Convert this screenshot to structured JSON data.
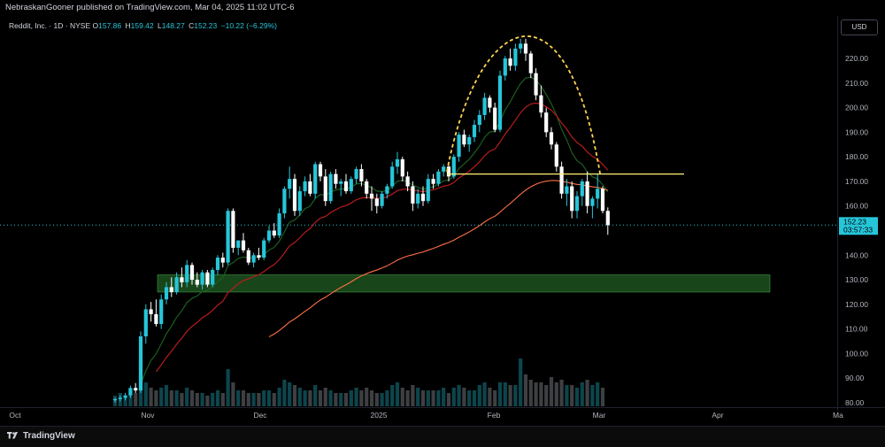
{
  "header": {
    "published": "NebraskanGooner published on TradingView.com, Mar 04, 2025 11:02 UTC-6"
  },
  "legend": {
    "symbol": "Reddit, Inc. · 1D · NYSE",
    "o_label": "O",
    "o": "157.86",
    "h_label": "H",
    "h": "159.42",
    "l_label": "L",
    "l": "148.27",
    "c_label": "C",
    "c": "152.23",
    "change": "−10.22 (−6.29%)"
  },
  "currency": "USD",
  "price_tag": {
    "price": "152.23",
    "countdown": "03:57:33"
  },
  "footer": {
    "brand": "TradingView"
  },
  "colors": {
    "up": "#26c6da",
    "down": "#ffffff",
    "ema_short": "#1b5e20",
    "ema_mid": "#b71c1c",
    "ema_long": "#ff7043",
    "arc": "#ffd54f",
    "support_line": "#fff176",
    "zone": "#2e7d32"
  },
  "chart_data": {
    "type": "candlestick",
    "ylim": [
      80,
      230
    ],
    "y_ticks": [
      80,
      90,
      100,
      110,
      120,
      130,
      140,
      150,
      160,
      170,
      180,
      190,
      200,
      210,
      220
    ],
    "x_ticks": [
      "Oct",
      "Nov",
      "Dec",
      "2025",
      "Feb",
      "Mar",
      "Apr",
      "Ma"
    ],
    "last_close": 152.23,
    "support_level": 173,
    "demand_zone": [
      125,
      132
    ],
    "candles": [
      {
        "o": 81,
        "h": 82,
        "l": 80,
        "c": 81.5
      },
      {
        "o": 81.5,
        "h": 83,
        "l": 80.5,
        "c": 82
      },
      {
        "o": 82,
        "h": 84,
        "l": 81,
        "c": 83
      },
      {
        "o": 83,
        "h": 87,
        "l": 82,
        "c": 86
      },
      {
        "o": 86,
        "h": 88,
        "l": 84,
        "c": 85
      },
      {
        "o": 85,
        "h": 109,
        "l": 84,
        "c": 107
      },
      {
        "o": 107,
        "h": 120,
        "l": 104,
        "c": 118
      },
      {
        "o": 118,
        "h": 121,
        "l": 113,
        "c": 116
      },
      {
        "o": 116,
        "h": 122,
        "l": 111,
        "c": 112
      },
      {
        "o": 112,
        "h": 124,
        "l": 110,
        "c": 122
      },
      {
        "o": 122,
        "h": 129,
        "l": 120,
        "c": 127
      },
      {
        "o": 127,
        "h": 131,
        "l": 123,
        "c": 125
      },
      {
        "o": 125,
        "h": 133,
        "l": 124,
        "c": 131
      },
      {
        "o": 131,
        "h": 135,
        "l": 127,
        "c": 129
      },
      {
        "o": 129,
        "h": 138,
        "l": 127,
        "c": 136
      },
      {
        "o": 136,
        "h": 137,
        "l": 128,
        "c": 130
      },
      {
        "o": 130,
        "h": 133,
        "l": 127,
        "c": 128
      },
      {
        "o": 128,
        "h": 134,
        "l": 126,
        "c": 133
      },
      {
        "o": 133,
        "h": 134,
        "l": 127,
        "c": 128
      },
      {
        "o": 128,
        "h": 135,
        "l": 127,
        "c": 134
      },
      {
        "o": 134,
        "h": 140,
        "l": 132,
        "c": 139
      },
      {
        "o": 139,
        "h": 141,
        "l": 135,
        "c": 137
      },
      {
        "o": 137,
        "h": 159,
        "l": 136,
        "c": 158
      },
      {
        "o": 158,
        "h": 159,
        "l": 141,
        "c": 143
      },
      {
        "o": 143,
        "h": 146,
        "l": 140,
        "c": 146
      },
      {
        "o": 146,
        "h": 149,
        "l": 141,
        "c": 142
      },
      {
        "o": 142,
        "h": 143,
        "l": 136,
        "c": 137
      },
      {
        "o": 137,
        "h": 141,
        "l": 135,
        "c": 140
      },
      {
        "o": 140,
        "h": 143,
        "l": 138,
        "c": 139
      },
      {
        "o": 139,
        "h": 147,
        "l": 138,
        "c": 146
      },
      {
        "o": 146,
        "h": 152,
        "l": 145,
        "c": 150
      },
      {
        "o": 150,
        "h": 153,
        "l": 147,
        "c": 148
      },
      {
        "o": 148,
        "h": 159,
        "l": 147,
        "c": 157
      },
      {
        "o": 157,
        "h": 168,
        "l": 155,
        "c": 167
      },
      {
        "o": 167,
        "h": 176,
        "l": 163,
        "c": 171
      },
      {
        "o": 171,
        "h": 173,
        "l": 156,
        "c": 158
      },
      {
        "o": 158,
        "h": 168,
        "l": 156,
        "c": 166
      },
      {
        "o": 166,
        "h": 172,
        "l": 164,
        "c": 170
      },
      {
        "o": 170,
        "h": 173,
        "l": 164,
        "c": 165
      },
      {
        "o": 165,
        "h": 178,
        "l": 163,
        "c": 177
      },
      {
        "o": 177,
        "h": 178,
        "l": 170,
        "c": 172
      },
      {
        "o": 172,
        "h": 175,
        "l": 160,
        "c": 162
      },
      {
        "o": 162,
        "h": 174,
        "l": 161,
        "c": 173
      },
      {
        "o": 173,
        "h": 175,
        "l": 167,
        "c": 169
      },
      {
        "o": 169,
        "h": 171,
        "l": 164,
        "c": 170
      },
      {
        "o": 170,
        "h": 173,
        "l": 165,
        "c": 166
      },
      {
        "o": 166,
        "h": 172,
        "l": 165,
        "c": 171
      },
      {
        "o": 171,
        "h": 176,
        "l": 169,
        "c": 175
      },
      {
        "o": 175,
        "h": 177,
        "l": 168,
        "c": 170
      },
      {
        "o": 170,
        "h": 171,
        "l": 163,
        "c": 165
      },
      {
        "o": 165,
        "h": 168,
        "l": 158,
        "c": 163
      },
      {
        "o": 163,
        "h": 165,
        "l": 157,
        "c": 160
      },
      {
        "o": 160,
        "h": 166,
        "l": 159,
        "c": 165
      },
      {
        "o": 165,
        "h": 169,
        "l": 163,
        "c": 168
      },
      {
        "o": 168,
        "h": 178,
        "l": 167,
        "c": 176
      },
      {
        "o": 176,
        "h": 182,
        "l": 173,
        "c": 179
      },
      {
        "o": 179,
        "h": 180,
        "l": 170,
        "c": 172
      },
      {
        "o": 172,
        "h": 174,
        "l": 166,
        "c": 168
      },
      {
        "o": 168,
        "h": 170,
        "l": 158,
        "c": 161
      },
      {
        "o": 161,
        "h": 167,
        "l": 159,
        "c": 165
      },
      {
        "o": 165,
        "h": 168,
        "l": 160,
        "c": 162
      },
      {
        "o": 162,
        "h": 173,
        "l": 161,
        "c": 171
      },
      {
        "o": 171,
        "h": 173,
        "l": 167,
        "c": 169
      },
      {
        "o": 169,
        "h": 175,
        "l": 168,
        "c": 174
      },
      {
        "o": 174,
        "h": 177,
        "l": 172,
        "c": 176
      },
      {
        "o": 176,
        "h": 178,
        "l": 170,
        "c": 172
      },
      {
        "o": 172,
        "h": 181,
        "l": 171,
        "c": 180
      },
      {
        "o": 180,
        "h": 190,
        "l": 178,
        "c": 189
      },
      {
        "o": 189,
        "h": 191,
        "l": 184,
        "c": 185
      },
      {
        "o": 185,
        "h": 189,
        "l": 182,
        "c": 188
      },
      {
        "o": 188,
        "h": 195,
        "l": 186,
        "c": 193
      },
      {
        "o": 193,
        "h": 199,
        "l": 190,
        "c": 197
      },
      {
        "o": 197,
        "h": 206,
        "l": 195,
        "c": 204
      },
      {
        "o": 204,
        "h": 205,
        "l": 198,
        "c": 200
      },
      {
        "o": 200,
        "h": 202,
        "l": 190,
        "c": 191
      },
      {
        "o": 191,
        "h": 215,
        "l": 190,
        "c": 213
      },
      {
        "o": 213,
        "h": 221,
        "l": 211,
        "c": 220
      },
      {
        "o": 220,
        "h": 224,
        "l": 215,
        "c": 217
      },
      {
        "o": 217,
        "h": 226,
        "l": 215,
        "c": 224
      },
      {
        "o": 224,
        "h": 228,
        "l": 222,
        "c": 226
      },
      {
        "o": 226,
        "h": 228,
        "l": 219,
        "c": 222
      },
      {
        "o": 222,
        "h": 223,
        "l": 212,
        "c": 214
      },
      {
        "o": 214,
        "h": 216,
        "l": 203,
        "c": 205
      },
      {
        "o": 205,
        "h": 209,
        "l": 196,
        "c": 198
      },
      {
        "o": 198,
        "h": 200,
        "l": 188,
        "c": 190
      },
      {
        "o": 190,
        "h": 192,
        "l": 183,
        "c": 185
      },
      {
        "o": 185,
        "h": 186,
        "l": 174,
        "c": 176
      },
      {
        "o": 176,
        "h": 178,
        "l": 163,
        "c": 165
      },
      {
        "o": 165,
        "h": 171,
        "l": 160,
        "c": 168
      },
      {
        "o": 168,
        "h": 170,
        "l": 155,
        "c": 158
      },
      {
        "o": 158,
        "h": 166,
        "l": 155,
        "c": 164
      },
      {
        "o": 164,
        "h": 171,
        "l": 160,
        "c": 170
      },
      {
        "o": 170,
        "h": 174,
        "l": 157,
        "c": 160
      },
      {
        "o": 160,
        "h": 164,
        "l": 155,
        "c": 163
      },
      {
        "o": 163,
        "h": 173,
        "l": 159,
        "c": 167
      },
      {
        "o": 167,
        "h": 168,
        "l": 157,
        "c": 158
      },
      {
        "o": 158,
        "h": 159.42,
        "l": 148.27,
        "c": 152.23
      }
    ],
    "volume": [
      4,
      5,
      4,
      6,
      5,
      18,
      9,
      7,
      6,
      7,
      8,
      6,
      6,
      5,
      7,
      6,
      5,
      5,
      4,
      5,
      6,
      5,
      14,
      9,
      6,
      6,
      5,
      5,
      5,
      6,
      6,
      5,
      7,
      10,
      9,
      8,
      7,
      6,
      6,
      8,
      6,
      7,
      6,
      5,
      5,
      5,
      6,
      7,
      6,
      7,
      6,
      5,
      5,
      6,
      8,
      9,
      7,
      6,
      8,
      7,
      6,
      6,
      6,
      6,
      7,
      5,
      7,
      8,
      7,
      6,
      6,
      8,
      9,
      7,
      6,
      9,
      9,
      8,
      8,
      18,
      12,
      10,
      9,
      9,
      8,
      11,
      9,
      10,
      8,
      8,
      7,
      9,
      10,
      8,
      9,
      7
    ]
  }
}
